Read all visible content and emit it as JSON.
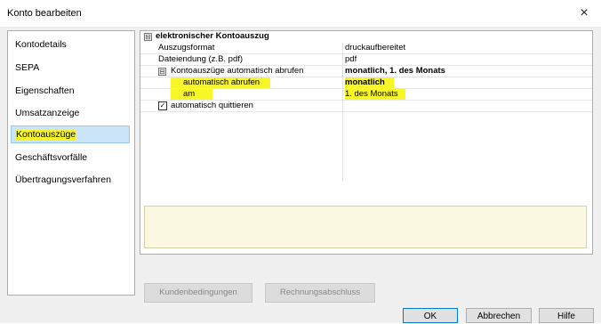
{
  "window": {
    "title": "Konto bearbeiten",
    "close_glyph": "×"
  },
  "nav": {
    "items": [
      {
        "label": "Kontodetails"
      },
      {
        "label": "SEPA"
      },
      {
        "label": "Eigenschaften"
      },
      {
        "label": "Umsatzanzeige"
      },
      {
        "label": "Kontoauszüge",
        "selected": true
      },
      {
        "label": "Geschäftsvorfälle"
      },
      {
        "label": "Übertragungsverfahren"
      }
    ]
  },
  "grid": {
    "section": {
      "toggle": "⊟",
      "label": "elektronischer Kontoauszug"
    },
    "rows": {
      "auszugsformat": {
        "name": "Auszugsformat",
        "value": "druckaufbereitet"
      },
      "dateiendung": {
        "name": "Dateiendung (z.B. pdf)",
        "value": "pdf"
      },
      "auto": {
        "toggle": "⊟",
        "name": "Kontoauszüge automatisch abrufen",
        "value": "monatlich, 1. des Monats"
      },
      "abrufen": {
        "name": "automatisch abrufen",
        "value": "monatlich"
      },
      "am": {
        "name": "am",
        "value": "1. des Monats"
      },
      "quittieren": {
        "name": "automatisch quittieren",
        "checked": true,
        "check_glyph": "✓"
      }
    }
  },
  "subbuttons": {
    "kunden": {
      "label": "Kundenbedingungen"
    },
    "rechnung": {
      "label": "Rechnungsabschluss"
    }
  },
  "footer": {
    "ok": "OK",
    "cancel": "Abbrechen",
    "help": "Hilfe"
  },
  "colors": {
    "highlight": "#f7f728",
    "selection": "#cce4f7",
    "description_bg": "#fcf9e2"
  }
}
